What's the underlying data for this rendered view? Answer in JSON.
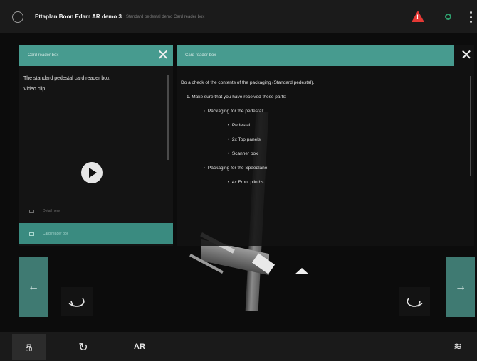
{
  "header": {
    "title": "Ettaplan Boon Edam AR demo 3",
    "breadcrumb": "Standard pedestal demo  Card reader box",
    "icons": [
      "app-icon",
      "warning-icon",
      "status-icon",
      "more-options-icon"
    ],
    "warning_color": "#e53935",
    "status_color": "#2fa06e"
  },
  "left_panel": {
    "header": "Card reader box",
    "description_line1": "The standard pedestal card reader box.",
    "description_line2": "Video clip.",
    "items": [
      {
        "label": "Detail here"
      },
      {
        "label": "Card reader box"
      }
    ]
  },
  "right_panel": {
    "header": "Card reader box",
    "intro": "Do a check of the contents of the packaging (Standard pedestal).",
    "step1": "1.  Make sure that you have received these parts:",
    "group1": "Packaging for the pedestal:",
    "group1_items": [
      "Pedestal",
      "2x Top panels",
      "Scanner box"
    ],
    "group2": "Packaging for the Speedlane:",
    "group2_items": [
      "4x Front plinths"
    ]
  },
  "nav": {
    "prev_label": "←",
    "next_label": "→"
  },
  "toolbar": {
    "sites_label": "品",
    "reset_label": "↻",
    "ar_label": "AR",
    "layers_label": "≋"
  },
  "accent_color": "#479b8f"
}
